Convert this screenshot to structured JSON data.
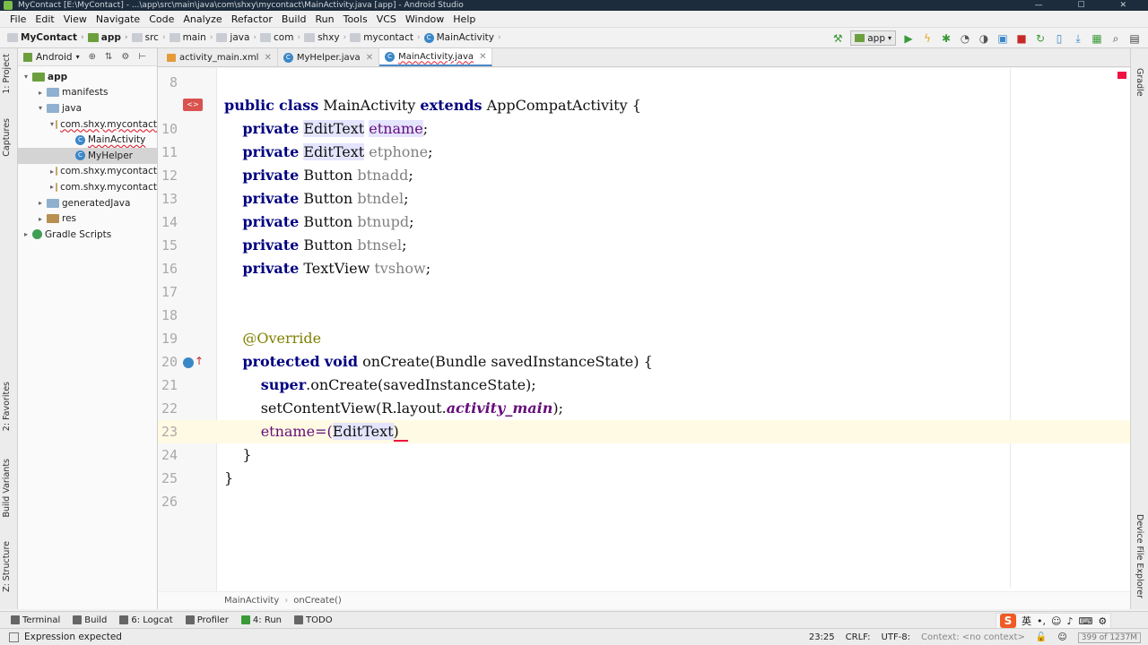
{
  "window": {
    "title": "MyContact [E:\\MyContact] - ...\\app\\src\\main\\java\\com\\shxy\\mycontact\\MainActivity.java [app] - Android Studio",
    "controls": "— ☐ ✕"
  },
  "menu": [
    "File",
    "Edit",
    "View",
    "Navigate",
    "Code",
    "Analyze",
    "Refactor",
    "Build",
    "Run",
    "Tools",
    "VCS",
    "Window",
    "Help"
  ],
  "breadcrumbs": [
    "MyContact",
    "app",
    "src",
    "main",
    "java",
    "com",
    "shxy",
    "mycontact",
    "MainActivity"
  ],
  "run_config": "app",
  "project_panel": {
    "view": "Android",
    "tree": [
      {
        "label": "app",
        "depth": 0,
        "arrow": "▾",
        "icon": "app"
      },
      {
        "label": "manifests",
        "depth": 1,
        "arrow": "▸",
        "icon": "folder"
      },
      {
        "label": "java",
        "depth": 1,
        "arrow": "▾",
        "icon": "folder"
      },
      {
        "label": "com.shxy.mycontact",
        "depth": 2,
        "arrow": "▾",
        "icon": "pkg",
        "error": true
      },
      {
        "label": "MainActivity",
        "depth": 3,
        "arrow": "",
        "icon": "class",
        "error": true
      },
      {
        "label": "MyHelper",
        "depth": 3,
        "arrow": "",
        "icon": "class",
        "selected": true
      },
      {
        "label": "com.shxy.mycontact",
        "depth": 2,
        "arrow": "▸",
        "icon": "pkg"
      },
      {
        "label": "com.shxy.mycontact",
        "depth": 2,
        "arrow": "▸",
        "icon": "pkg"
      },
      {
        "label": "generatedJava",
        "depth": 1,
        "arrow": "▸",
        "icon": "folder"
      },
      {
        "label": "res",
        "depth": 1,
        "arrow": "▸",
        "icon": "res"
      },
      {
        "label": "Gradle Scripts",
        "depth": 0,
        "arrow": "▸",
        "icon": "gradle"
      }
    ]
  },
  "tabs": [
    {
      "label": "activity_main.xml",
      "kind": "xml"
    },
    {
      "label": "MyHelper.java",
      "kind": "class"
    },
    {
      "label": "MainActivity.java",
      "kind": "class",
      "active": true,
      "error": true
    }
  ],
  "code": {
    "l8": "8",
    "l9": "9",
    "l10": "10",
    "l11": "11",
    "l12": "12",
    "l13": "13",
    "l14": "14",
    "l15": "15",
    "l16": "16",
    "l17": "17",
    "l18": "18",
    "l19": "19",
    "l20": "20",
    "l21": "21",
    "l22": "22",
    "l23": "23",
    "l24": "24",
    "l25": "25",
    "l26": "26",
    "public": "public",
    "class": "class",
    "private": "private",
    "protected": "protected",
    "void": "void",
    "super": "super",
    "extends": "extends",
    "classname": " MainActivity ",
    "superclass": " AppCompatActivity {",
    "edittext": "EditText",
    "button": "Button",
    "textview": "TextView",
    "etname": "etname",
    "etphone": "etphone",
    "btnadd": "btnadd",
    "btndel": "btndel",
    "btnupd": "btnupd",
    "btnsel": "btnsel",
    "tvshow": "tvshow",
    "semi": ";",
    "override": "@Override",
    "oncreate_sig": " onCreate(Bundle savedInstanceState) {",
    "super_call": ".onCreate(savedInstanceState);",
    "setcv_a": "setContentView(R.layout.",
    "setcv_b": "activity_main",
    "setcv_c": ");",
    "assign_a": "etname=(",
    "assign_b": "EditText",
    "assign_c": ")",
    "close_inner": "}",
    "close_outer": "}"
  },
  "code_crumbs": [
    "MainActivity",
    "onCreate()"
  ],
  "bottom_tabs": [
    "Terminal",
    "Build",
    "6: Logcat",
    "Profiler",
    "4: Run",
    "TODO"
  ],
  "status": {
    "message": "Expression expected",
    "position": "23:25",
    "line_sep": "CRLF:",
    "encoding": "UTF-8:",
    "context": "Context: <no context>",
    "memory": "399 of 1237M"
  },
  "side_tabs": {
    "left": [
      "1: Project",
      "Captures",
      "2: Favorites",
      "Build Variants",
      "Z: Structure"
    ],
    "right": [
      "Gradle",
      "Device File Explorer"
    ]
  },
  "ime": {
    "label": "英"
  }
}
